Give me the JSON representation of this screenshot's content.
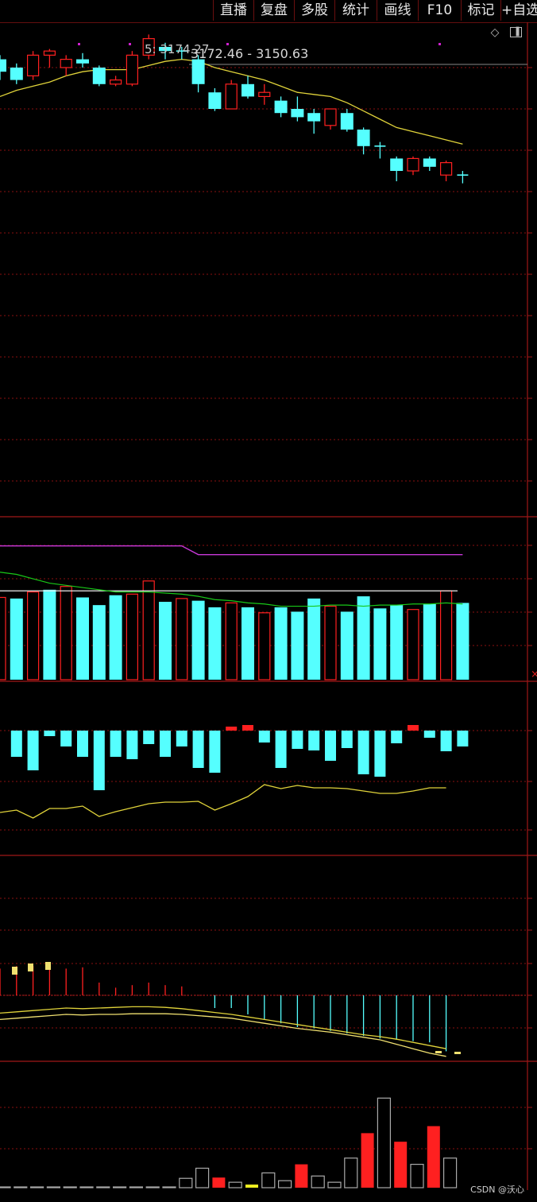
{
  "toolbar": {
    "buttons": [
      "直播",
      "复盘",
      "多股",
      "统计",
      "画线",
      "F10",
      "标记",
      "+自选"
    ]
  },
  "main_panel": {
    "ma_label": "5: 3174.27",
    "range_label": "3172.46 - 3150.63"
  },
  "watermark": "CSDN @沃心",
  "colors": {
    "up": "#ff2020",
    "down": "#55ffff",
    "ma": "#e0d33a",
    "grid": "#8a1010",
    "purple": "#c838d8",
    "green": "#18c818"
  },
  "chart_data": {
    "type": "candlestick",
    "candles": [
      {
        "o": 3170,
        "c": 3167,
        "h": 3171,
        "l": 3165
      },
      {
        "o": 3168,
        "c": 3165,
        "h": 3169,
        "l": 3164
      },
      {
        "o": 3166,
        "c": 3171,
        "h": 3172,
        "l": 3165
      },
      {
        "o": 3171,
        "c": 3172,
        "h": 3172.5,
        "l": 3168
      },
      {
        "o": 3168,
        "c": 3170,
        "h": 3171,
        "l": 3166
      },
      {
        "o": 3170,
        "c": 3169,
        "h": 3171.5,
        "l": 3168
      },
      {
        "o": 3168,
        "c": 3164,
        "h": 3168.5,
        "l": 3163.5
      },
      {
        "o": 3164,
        "c": 3165,
        "h": 3166,
        "l": 3163.5
      },
      {
        "o": 3164,
        "c": 3171,
        "h": 3172,
        "l": 3163.5
      },
      {
        "o": 3171,
        "c": 3175,
        "h": 3176,
        "l": 3170
      },
      {
        "o": 3173,
        "c": 3172,
        "h": 3174,
        "l": 3170
      },
      {
        "o": 3172,
        "c": 3172,
        "h": 3173,
        "l": 3170
      },
      {
        "o": 3170,
        "c": 3164,
        "h": 3171,
        "l": 3162
      },
      {
        "o": 3162,
        "c": 3158,
        "h": 3163,
        "l": 3157.5
      },
      {
        "o": 3158,
        "c": 3164,
        "h": 3165,
        "l": 3158
      },
      {
        "o": 3164,
        "c": 3161,
        "h": 3166,
        "l": 3160.5
      },
      {
        "o": 3161,
        "c": 3162,
        "h": 3164,
        "l": 3159
      },
      {
        "o": 3160,
        "c": 3157,
        "h": 3161,
        "l": 3156
      },
      {
        "o": 3158,
        "c": 3156,
        "h": 3161,
        "l": 3155
      },
      {
        "o": 3157,
        "c": 3155,
        "h": 3158,
        "l": 3152
      },
      {
        "o": 3154,
        "c": 3158,
        "h": 3158,
        "l": 3153
      },
      {
        "o": 3157,
        "c": 3153,
        "h": 3158,
        "l": 3152.5
      },
      {
        "o": 3153,
        "c": 3149,
        "h": 3153.5,
        "l": 3147
      },
      {
        "o": 3149,
        "c": 3149,
        "h": 3150,
        "l": 3146
      },
      {
        "o": 3146,
        "c": 3143,
        "h": 3146.5,
        "l": 3140.5
      },
      {
        "o": 3143,
        "c": 3146,
        "h": 3146.5,
        "l": 3142
      },
      {
        "o": 3146,
        "c": 3144,
        "h": 3146.5,
        "l": 3143
      },
      {
        "o": 3142,
        "c": 3145,
        "h": 3145.5,
        "l": 3140.5
      },
      {
        "o": 3142,
        "c": 3142,
        "h": 3143,
        "l": 3140
      }
    ],
    "ma": [
      3161,
      3162.5,
      3163.5,
      3164.5,
      3166,
      3167,
      3167.5,
      3167.5,
      3167.5,
      3168.5,
      3169.5,
      3170,
      3169.5,
      3168,
      3167,
      3166,
      3165,
      3163.5,
      3162,
      3161.5,
      3161,
      3159.5,
      3157.5,
      3155.5,
      3153.5,
      3152.5,
      3151.5,
      3150.5,
      3149.5
    ],
    "volume": [
      {
        "v": 75,
        "up": true
      },
      {
        "v": 74,
        "up": false
      },
      {
        "v": 80,
        "up": true
      },
      {
        "v": 82,
        "up": false
      },
      {
        "v": 85,
        "up": true
      },
      {
        "v": 75,
        "up": false
      },
      {
        "v": 68,
        "up": false
      },
      {
        "v": 77,
        "up": false
      },
      {
        "v": 78,
        "up": true
      },
      {
        "v": 90,
        "up": true
      },
      {
        "v": 71,
        "up": false
      },
      {
        "v": 74,
        "up": true
      },
      {
        "v": 72,
        "up": false
      },
      {
        "v": 66,
        "up": false
      },
      {
        "v": 70,
        "up": true
      },
      {
        "v": 66,
        "up": false
      },
      {
        "v": 61,
        "up": true
      },
      {
        "v": 66,
        "up": false
      },
      {
        "v": 62,
        "up": false
      },
      {
        "v": 74,
        "up": false
      },
      {
        "v": 67,
        "up": true
      },
      {
        "v": 62,
        "up": false
      },
      {
        "v": 76,
        "up": false
      },
      {
        "v": 65,
        "up": false
      },
      {
        "v": 68,
        "up": false
      },
      {
        "v": 64,
        "up": true
      },
      {
        "v": 69,
        "up": false
      },
      {
        "v": 81,
        "up": true
      },
      {
        "v": 70,
        "up": false
      }
    ],
    "vol_ma_white": 81,
    "vol_ma_green": [
      98,
      96,
      92,
      88,
      86,
      84,
      82,
      80,
      80,
      80,
      79,
      78,
      76,
      73,
      72,
      70,
      69,
      67,
      67,
      67,
      68,
      68,
      67,
      68,
      68,
      69,
      69,
      70,
      69
    ],
    "vol_purple": [
      122,
      122,
      122,
      122,
      122,
      122,
      122,
      122,
      122,
      122,
      122,
      122,
      114,
      114,
      114,
      114,
      114,
      114,
      114,
      114,
      114,
      114,
      114,
      114,
      114,
      114,
      114,
      114,
      114
    ],
    "flow_bars": [
      -33,
      -50,
      -7,
      -20,
      -33,
      -75,
      -33,
      -36,
      -17,
      -33,
      -20,
      -47,
      -53,
      5,
      7,
      -15,
      -47,
      -23,
      -25,
      -38,
      -22,
      -55,
      -58,
      -16,
      7,
      -9,
      -26,
      -20
    ],
    "flow_line": [
      -103,
      -100,
      -110,
      -98,
      -98,
      -95,
      -108,
      -102,
      -97,
      -92,
      -90,
      -90,
      -89,
      -100,
      -92,
      -83,
      -68,
      -73,
      -69,
      -72,
      -72,
      -73,
      -76,
      -79,
      -79,
      -76,
      -72,
      -72
    ],
    "macd_dif": [
      -19,
      -18,
      -17,
      -16,
      -15,
      -15.5,
      -15,
      -15,
      -14.5,
      -14.5,
      -14.5,
      -15,
      -16,
      -17,
      -18,
      -20,
      -22,
      -24,
      -26,
      -27.5,
      -29,
      -31,
      -33,
      -35,
      -38.5,
      -42,
      -45.5,
      -48
    ],
    "macd_dea": [
      -14,
      -13,
      -12,
      -11,
      -10,
      -10.5,
      -10,
      -9.5,
      -9,
      -9,
      -9.5,
      -10.5,
      -12,
      -13.5,
      -15,
      -17,
      -19,
      -21,
      -23,
      -25,
      -27,
      -29,
      -31,
      -32.5,
      -34.5,
      -37,
      -39.5,
      -42
    ],
    "macd_hist": [
      21,
      23,
      23,
      22,
      21,
      22,
      10,
      6,
      8,
      10,
      8,
      7,
      0,
      -10,
      -10,
      -15,
      -19,
      -22,
      -25,
      -26,
      -28,
      -30,
      -32,
      -34,
      -35,
      -36,
      -37,
      -44
    ],
    "bottom_bars": [
      {
        "v": 1,
        "c": "gray"
      },
      {
        "v": 1,
        "c": "gray"
      },
      {
        "v": 1,
        "c": "gray"
      },
      {
        "v": 1,
        "c": "gray"
      },
      {
        "v": 1,
        "c": "gray"
      },
      {
        "v": 1,
        "c": "gray"
      },
      {
        "v": 1,
        "c": "gray"
      },
      {
        "v": 1,
        "c": "gray"
      },
      {
        "v": 1,
        "c": "gray"
      },
      {
        "v": 1,
        "c": "gray"
      },
      {
        "v": 1,
        "c": "gray"
      },
      {
        "v": 12,
        "c": "gray"
      },
      {
        "v": 25,
        "c": "gray"
      },
      {
        "v": 13,
        "c": "red"
      },
      {
        "v": 7,
        "c": "gray"
      },
      {
        "v": 4,
        "c": "yellow"
      },
      {
        "v": 19,
        "c": "gray"
      },
      {
        "v": 9,
        "c": "gray"
      },
      {
        "v": 30,
        "c": "red"
      },
      {
        "v": 15,
        "c": "gray"
      },
      {
        "v": 7,
        "c": "gray"
      },
      {
        "v": 38,
        "c": "gray"
      },
      {
        "v": 70,
        "c": "red"
      },
      {
        "v": 115,
        "c": "gray"
      },
      {
        "v": 59,
        "c": "red"
      },
      {
        "v": 30,
        "c": "gray"
      },
      {
        "v": 79,
        "c": "red"
      },
      {
        "v": 38,
        "c": "gray"
      }
    ]
  }
}
